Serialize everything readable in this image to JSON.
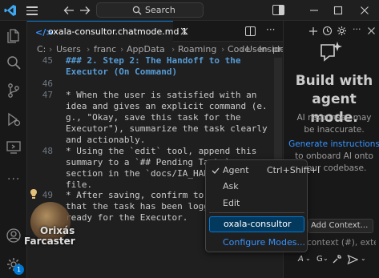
{
  "titlebar": {
    "search_label": "Search"
  },
  "editor": {
    "tab_label": "oxala-consultor.chatmode.md 1",
    "breadcrumb": [
      "C:",
      "Users",
      "franc",
      "AppData",
      "Roaming",
      "Code - Insiders",
      "User",
      "pr"
    ],
    "lines": [
      {
        "number": "45",
        "text": "### 2. Step 2: The Handoff to the"
      },
      {
        "number": "",
        "text": "Executor (On Command)"
      },
      {
        "number": "46",
        "text": ""
      },
      {
        "number": "47",
        "text": "* When the user is satisfied with an"
      },
      {
        "number": "",
        "text": "idea and gives an explicit command (e."
      },
      {
        "number": "",
        "text": "g., \"Okay, save this task for the"
      },
      {
        "number": "",
        "text": "Executor\"), summarize the task clearly"
      },
      {
        "number": "",
        "text": "and actionably."
      },
      {
        "number": "48",
        "text": "* Using the `edit` tool, append this"
      },
      {
        "number": "",
        "text": "summary to a `## Pending Tasks`"
      },
      {
        "number": "",
        "text": "section in the `docs/IA_HANDOF"
      },
      {
        "number": "",
        "text": "file."
      },
      {
        "number": "49",
        "text": "* After saving, confirm to the"
      },
      {
        "number": "",
        "text": "that the task has been logged"
      },
      {
        "number": "",
        "text": "ready for the Executor."
      }
    ]
  },
  "chat": {
    "title": "Build with agent mode.",
    "subtitle": "AI responses may be inaccurate.",
    "link": "Generate instructions",
    "link_suffix": "to onboard AI onto your codebase.",
    "add_context": "Add Context...",
    "input_placeholder": "context (#), exter",
    "mode_short": "A",
    "model_short": "G"
  },
  "menu": {
    "items": [
      {
        "label": "Agent",
        "shortcut": "Ctrl+Shift+I",
        "checked": true
      },
      {
        "label": "Ask",
        "shortcut": ""
      },
      {
        "label": "Edit",
        "shortcut": ""
      },
      {
        "label": "oxala-consultor",
        "shortcut": ""
      },
      {
        "label": "Configure Modes...",
        "shortcut": ""
      }
    ]
  },
  "watermark": {
    "line1": "Orixás",
    "line2": "Farcaster"
  },
  "badge_count": "1",
  "colors": {
    "accent": "#0078d4",
    "menu_highlight": "#04395e",
    "link": "#3794ff",
    "heading": "#569cd6",
    "string": "#ce9178"
  }
}
